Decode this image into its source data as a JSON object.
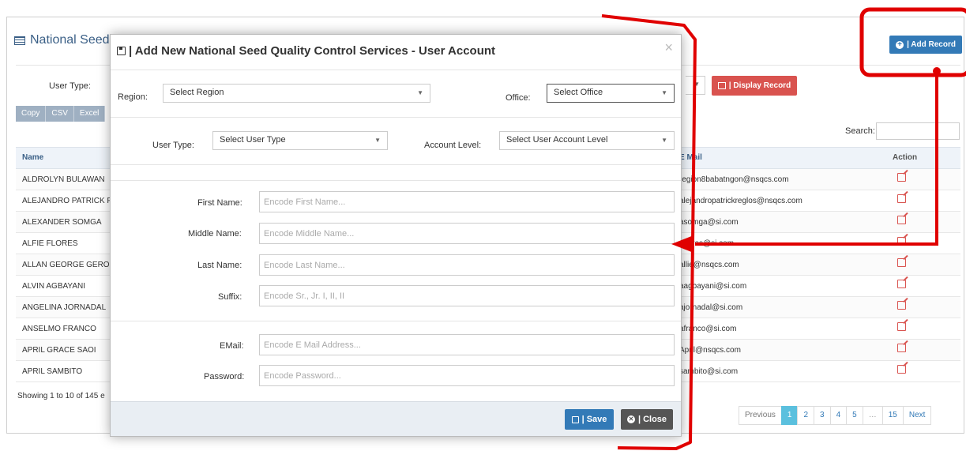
{
  "background": {
    "title": "National Seed",
    "user_type_label": "User Type:",
    "export_buttons": [
      "Copy",
      "CSV",
      "Excel"
    ],
    "display_record_label": "| Display Record",
    "add_record_label": "| Add Record",
    "search_label": "Search:",
    "table": {
      "headers": {
        "name": "Name",
        "email": "E Mail",
        "action": "Action"
      },
      "rows": [
        {
          "name": "ALDROLYN BULAWAN",
          "email": "region8babatngon@nsqcs.com"
        },
        {
          "name": "ALEJANDRO PATRICK F",
          "email": "alejandropatrickreglos@nsqcs.com"
        },
        {
          "name": "ALEXANDER SOMGA",
          "email": "asomga@si.com"
        },
        {
          "name": "ALFIE FLORES",
          "email": "aflores@si.com"
        },
        {
          "name": "ALLAN GEORGE GERO",
          "email": "allie@nsqcs.com"
        },
        {
          "name": "ALVIN AGBAYANI",
          "email": "aagbayani@si.com"
        },
        {
          "name": "ANGELINA JORNADAL",
          "email": "ajornadal@si.com"
        },
        {
          "name": "ANSELMO FRANCO",
          "email": "afranco@si.com"
        },
        {
          "name": "APRIL GRACE SAOI",
          "email": "April@nsqcs.com"
        },
        {
          "name": "APRIL SAMBITO",
          "email": "sambito@si.com"
        }
      ]
    },
    "showing_text": "Showing 1 to 10 of 145 e",
    "pagination": {
      "previous": "Previous",
      "pages": [
        "1",
        "2",
        "3",
        "4",
        "5",
        "…",
        "15"
      ],
      "next": "Next",
      "active_page": "1"
    }
  },
  "modal": {
    "title": "| Add New National Seed Quality Control Services - User Account",
    "close_symbol": "×",
    "region": {
      "label": "Region:",
      "value": "Select Region"
    },
    "office": {
      "label": "Office:",
      "value": "Select Office"
    },
    "user_type": {
      "label": "User Type:",
      "value": "Select User Type"
    },
    "account_level": {
      "label": "Account Level:",
      "value": "Select User Account Level"
    },
    "first_name": {
      "label": "First Name:",
      "placeholder": "Encode First Name..."
    },
    "middle_name": {
      "label": "Middle Name:",
      "placeholder": "Encode Middle Name..."
    },
    "last_name": {
      "label": "Last Name:",
      "placeholder": "Encode Last Name..."
    },
    "suffix": {
      "label": "Suffix:",
      "placeholder": "Encode Sr., Jr. I, II, II"
    },
    "email": {
      "label": "EMail:",
      "placeholder": "Encode E Mail Address..."
    },
    "password": {
      "label": "Password:",
      "placeholder": "Encode Password..."
    },
    "save_label": "| Save",
    "close_label": "| Close"
  },
  "colors": {
    "primary": "#337ab7",
    "danger": "#d9534f",
    "annotation": "#e00000",
    "dark_button": "#555555"
  }
}
